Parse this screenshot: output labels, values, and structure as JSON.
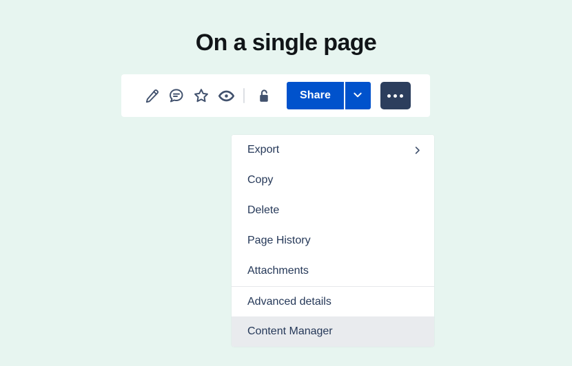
{
  "page": {
    "title": "On a single page",
    "background_color": "#E7F5F0"
  },
  "toolbar": {
    "icons": [
      {
        "name": "edit-pencil-icon",
        "label": "Edit"
      },
      {
        "name": "comment-icon",
        "label": "Comment"
      },
      {
        "name": "star-icon",
        "label": "Star"
      },
      {
        "name": "watch-eye-icon",
        "label": "Watch"
      },
      {
        "name": "unlock-padlock-icon",
        "label": "Restrictions"
      }
    ],
    "share_label": "Share",
    "share_color": "#0052CC",
    "more_button_color": "#2C3E5D",
    "more_label": "More actions"
  },
  "dropdown": {
    "items": [
      {
        "label": "Export",
        "has_submenu": true,
        "hovered": false,
        "divider_above": false
      },
      {
        "label": "Copy",
        "has_submenu": false,
        "hovered": false,
        "divider_above": false
      },
      {
        "label": "Delete",
        "has_submenu": false,
        "hovered": false,
        "divider_above": false
      },
      {
        "label": "Page History",
        "has_submenu": false,
        "hovered": false,
        "divider_above": false
      },
      {
        "label": "Attachments",
        "has_submenu": false,
        "hovered": false,
        "divider_above": false
      },
      {
        "label": "Advanced details",
        "has_submenu": false,
        "hovered": false,
        "divider_above": true
      },
      {
        "label": "Content Manager",
        "has_submenu": false,
        "hovered": true,
        "divider_above": false
      }
    ],
    "hover_color": "#E9EBEE",
    "text_color": "#253858"
  }
}
